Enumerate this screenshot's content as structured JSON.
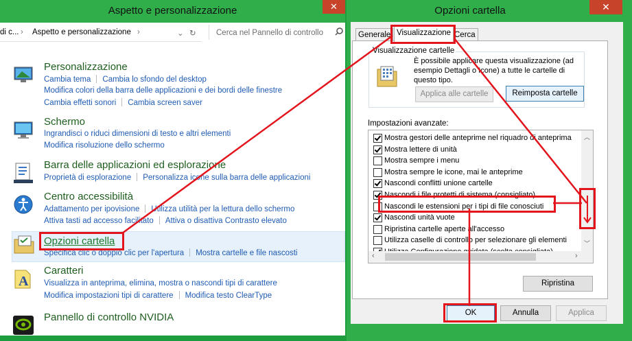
{
  "control_panel": {
    "title": "Aspetto e personalizzazione",
    "close": "✕",
    "address": {
      "prefix": "di c...",
      "crumb": "Aspetto e personalizzazione"
    },
    "search_placeholder": "Cerca nel Pannello di controllo",
    "categories": [
      {
        "title": "Personalizzazione",
        "links": [
          [
            "Cambia tema",
            "Cambia lo sfondo del desktop"
          ],
          [
            "Modifica colori della barra delle applicazioni e dei bordi delle finestre"
          ],
          [
            "Cambia effetti sonori",
            "Cambia screen saver"
          ]
        ]
      },
      {
        "title": "Schermo",
        "links": [
          [
            "Ingrandisci o riduci dimensioni di testo e altri elementi"
          ],
          [
            "Modifica risoluzione dello schermo"
          ]
        ]
      },
      {
        "title": "Barra delle applicazioni ed esplorazione",
        "links": [
          [
            "Proprietà di esplorazione",
            "Personalizza icone sulla barra delle applicazioni"
          ]
        ]
      },
      {
        "title": "Centro accessibilità",
        "links": [
          [
            "Adattamento per ipovisione",
            "Utilizza utilità per la lettura dello schermo"
          ],
          [
            "Attiva tasti ad accesso facilitato",
            "Attiva o disattiva Contrasto elevato"
          ]
        ]
      },
      {
        "title": "Opzioni cartella",
        "links": [
          [
            "Specifica clic o doppio clic per l'apertura",
            "Mostra cartelle e file nascosti"
          ]
        ]
      },
      {
        "title": "Caratteri",
        "links": [
          [
            "Visualizza in anteprima, elimina, mostra o nascondi tipi di carattere"
          ],
          [
            "Modifica impostazioni tipi di carattere",
            "Modifica testo ClearType"
          ]
        ]
      },
      {
        "title": "Pannello di controllo NVIDIA",
        "links": []
      }
    ]
  },
  "dialog": {
    "title": "Opzioni cartella",
    "close": "✕",
    "tabs": [
      "Generale",
      "Visualizzazione",
      "Cerca"
    ],
    "group_title": "Visualizzazione cartelle",
    "group_text": "È possibile applicare questa visualizzazione (ad esempio Dettagli o Icone) a tutte le cartelle di questo tipo.",
    "apply_folders": "Applica alle cartelle",
    "reset_folders": "Reimposta cartelle",
    "advanced_label": "Impostazioni avanzate:",
    "settings": [
      {
        "label": "Mostra gestori delle anteprime nel riquadro di anteprima",
        "checked": true
      },
      {
        "label": "Mostra lettere di unità",
        "checked": true
      },
      {
        "label": "Mostra sempre i menu",
        "checked": false
      },
      {
        "label": "Mostra sempre le icone, mai le anteprime",
        "checked": false
      },
      {
        "label": "Nascondi conflitti unione cartelle",
        "checked": true
      },
      {
        "label": "Nascondi i file protetti di sistema (consigliato)",
        "checked": true
      },
      {
        "label": "Nascondi le estensioni per i tipi di file conosciuti",
        "checked": false
      },
      {
        "label": "Nascondi unità vuote",
        "checked": true
      },
      {
        "label": "Ripristina cartelle aperte all'accesso",
        "checked": false
      },
      {
        "label": "Utilizza caselle di controllo per selezionare gli elementi",
        "checked": false
      },
      {
        "label": "Utilizza Configurazione guidata (scelta consigliata)",
        "checked": true
      }
    ],
    "restore": "Ripristina",
    "ok": "OK",
    "cancel": "Annulla",
    "apply": "Applica"
  },
  "colors": {
    "accent": "#2fae4a",
    "highlight": "#e3141c",
    "link": "#1f5bb3"
  }
}
